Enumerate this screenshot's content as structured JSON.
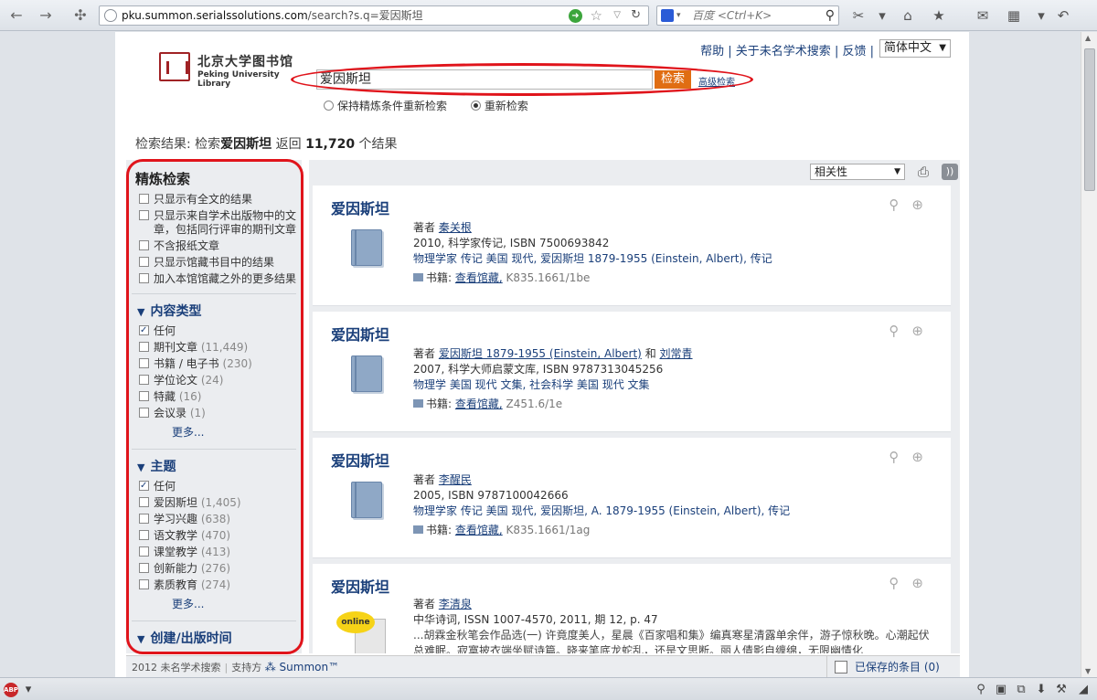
{
  "browser": {
    "url_domain": "pku.summon.serialssolutions.com",
    "url_prefix": "",
    "url_suffix": "/search?s.q=爱因斯坦",
    "search_placeholder": "百度 <Ctrl+K>"
  },
  "header": {
    "logo_cn": "北京大学图书馆",
    "logo_en": "Peking University Library",
    "links": [
      "帮助",
      "关于未名学术搜索",
      "反馈"
    ],
    "language": "简体中文"
  },
  "search": {
    "query": "爱因斯坦",
    "button": "检索",
    "advanced": "高级检索",
    "option_keep": "保持精炼条件重新检索",
    "option_new": "重新检索"
  },
  "summary": {
    "prefix": "检索结果: 检索",
    "term": "爱因斯坦",
    "middle": " 返回 ",
    "count": "11,720",
    "suffix": " 个结果"
  },
  "sidebar": {
    "refine_title": "精炼检索",
    "refine_options": [
      "只显示有全文的结果",
      "只显示来自学术出版物中的文章，包括同行评审的期刊文章",
      "不含报纸文章",
      "只显示馆藏书目中的结果",
      "加入本馆馆藏之外的更多结果"
    ],
    "content_type": {
      "title": "内容类型",
      "items": [
        {
          "label": "任何",
          "count": "",
          "checked": true
        },
        {
          "label": "期刊文章",
          "count": "(11,449)"
        },
        {
          "label": "书籍 / 电子书",
          "count": "(230)"
        },
        {
          "label": "学位论文",
          "count": "(24)"
        },
        {
          "label": "特藏",
          "count": "(16)"
        },
        {
          "label": "会议录",
          "count": "(1)"
        }
      ],
      "more": "更多..."
    },
    "subject": {
      "title": "主题",
      "items": [
        {
          "label": "任何",
          "count": "",
          "checked": true
        },
        {
          "label": "爱因斯坦",
          "count": "(1,405)"
        },
        {
          "label": "学习兴趣",
          "count": "(638)"
        },
        {
          "label": "语文教学",
          "count": "(470)"
        },
        {
          "label": "课堂教学",
          "count": "(413)"
        },
        {
          "label": "创新能力",
          "count": "(276)"
        },
        {
          "label": "素质教育",
          "count": "(274)"
        }
      ],
      "more": "更多..."
    },
    "date": {
      "title": "创建/出版时间",
      "any": "任何"
    }
  },
  "toolbar": {
    "sort": "相关性"
  },
  "results": [
    {
      "title": "爱因斯坦",
      "author_label": "著者",
      "author": "秦关根",
      "pub": "2010, 科学家传记, ISBN 7500693842",
      "subjects": "物理学家 传记 美国 现代, 爱因斯坦 1879-1955 (Einstein, Albert), 传记",
      "hold_label": "书籍:",
      "hold_link": "查看馆藏,",
      "call": "K835.1661/1be"
    },
    {
      "title": "爱因斯坦",
      "author_label": "著者",
      "author": "爱因斯坦 1879-1955 (Einstein, Albert)",
      "author_and": "和",
      "author2": "刘常青",
      "pub": "2007, 科学大师启蒙文库, ISBN 9787313045256",
      "subjects": "物理学 美国 现代 文集, 社会科学 美国 现代 文集",
      "hold_label": "书籍:",
      "hold_link": "查看馆藏,",
      "call": "Z451.6/1e"
    },
    {
      "title": "爱因斯坦",
      "author_label": "著者",
      "author": "李醒民",
      "pub": "2005, ISBN 9787100042666",
      "subjects": "物理学家 传记 美国 现代, 爱因斯坦, A. 1879-1955 (Einstein, Albert), 传记",
      "hold_label": "书籍:",
      "hold_link": "查看馆藏,",
      "call": "K835.1661/1ag"
    },
    {
      "title": "爱因斯坦",
      "author_label": "著者",
      "author": "李清泉",
      "pub": "中华诗词, ISSN 1007-4570, 2011, 期 12, p. 47",
      "abstract": "...胡霖金秋笔会作品选(一) 许竟度美人，星晨《百家唱和集》编真寒星清露单余伴，游子惊秋晚。心潮起伏总难眠。寂寞披衣端坐赋诗篇。晓来笔底龙蛇乱，还是文思断。丽人倩影自缠绵，无限幽情化",
      "badge": "online"
    }
  ],
  "footer": {
    "copyright": "2012 未名学术搜索",
    "powered": "支持方",
    "brand": "Summon™",
    "saved": "已保存的条目 (0)"
  }
}
